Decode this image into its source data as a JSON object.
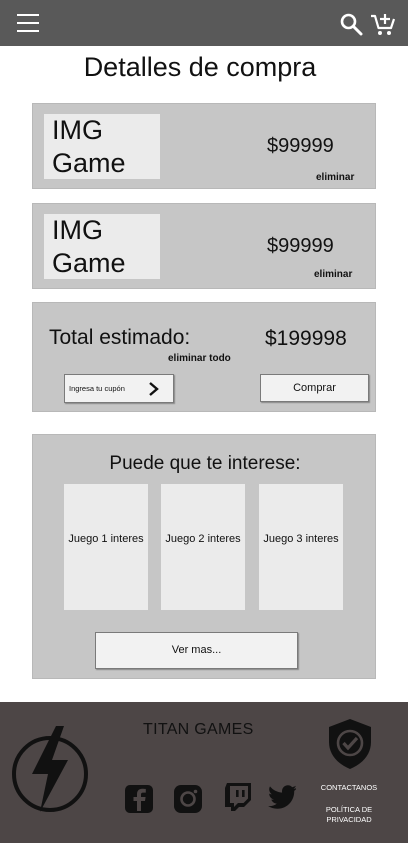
{
  "header": {
    "menu_icon": "hamburger-menu-icon",
    "search_icon": "search-icon",
    "cart_icon": "add-cart-icon"
  },
  "page": {
    "title": "Detalles de compra"
  },
  "cart": {
    "items": [
      {
        "image_placeholder": "IMG Game",
        "price": "$99999",
        "remove_label": "eliminar"
      },
      {
        "image_placeholder": "IMG Game",
        "price": "$99999",
        "remove_label": "eliminar"
      }
    ]
  },
  "summary": {
    "total_label": "Total estimado:",
    "total_value": "$199998",
    "remove_all_label": "eliminar todo",
    "coupon_placeholder": "Ingresa tu cupón",
    "buy_label": "Comprar"
  },
  "recommendations": {
    "title": "Puede que te interese:",
    "games": [
      {
        "label": "Juego 1 interes"
      },
      {
        "label": "Juego 2 interes"
      },
      {
        "label": "Juego 3 interes"
      }
    ],
    "more_label": "Ver mas..."
  },
  "footer": {
    "brand": "TITAN GAMES",
    "social_icons": [
      "facebook-icon",
      "instagram-icon",
      "twitch-icon",
      "twitter-icon"
    ],
    "contact_label": "CONTACTANOS",
    "privacy_label": "POLÍTICA DE PRIVACIDAD"
  },
  "colors": {
    "topbar": "#595959",
    "card": "#c6c6c6",
    "footer": "#4d4646"
  }
}
